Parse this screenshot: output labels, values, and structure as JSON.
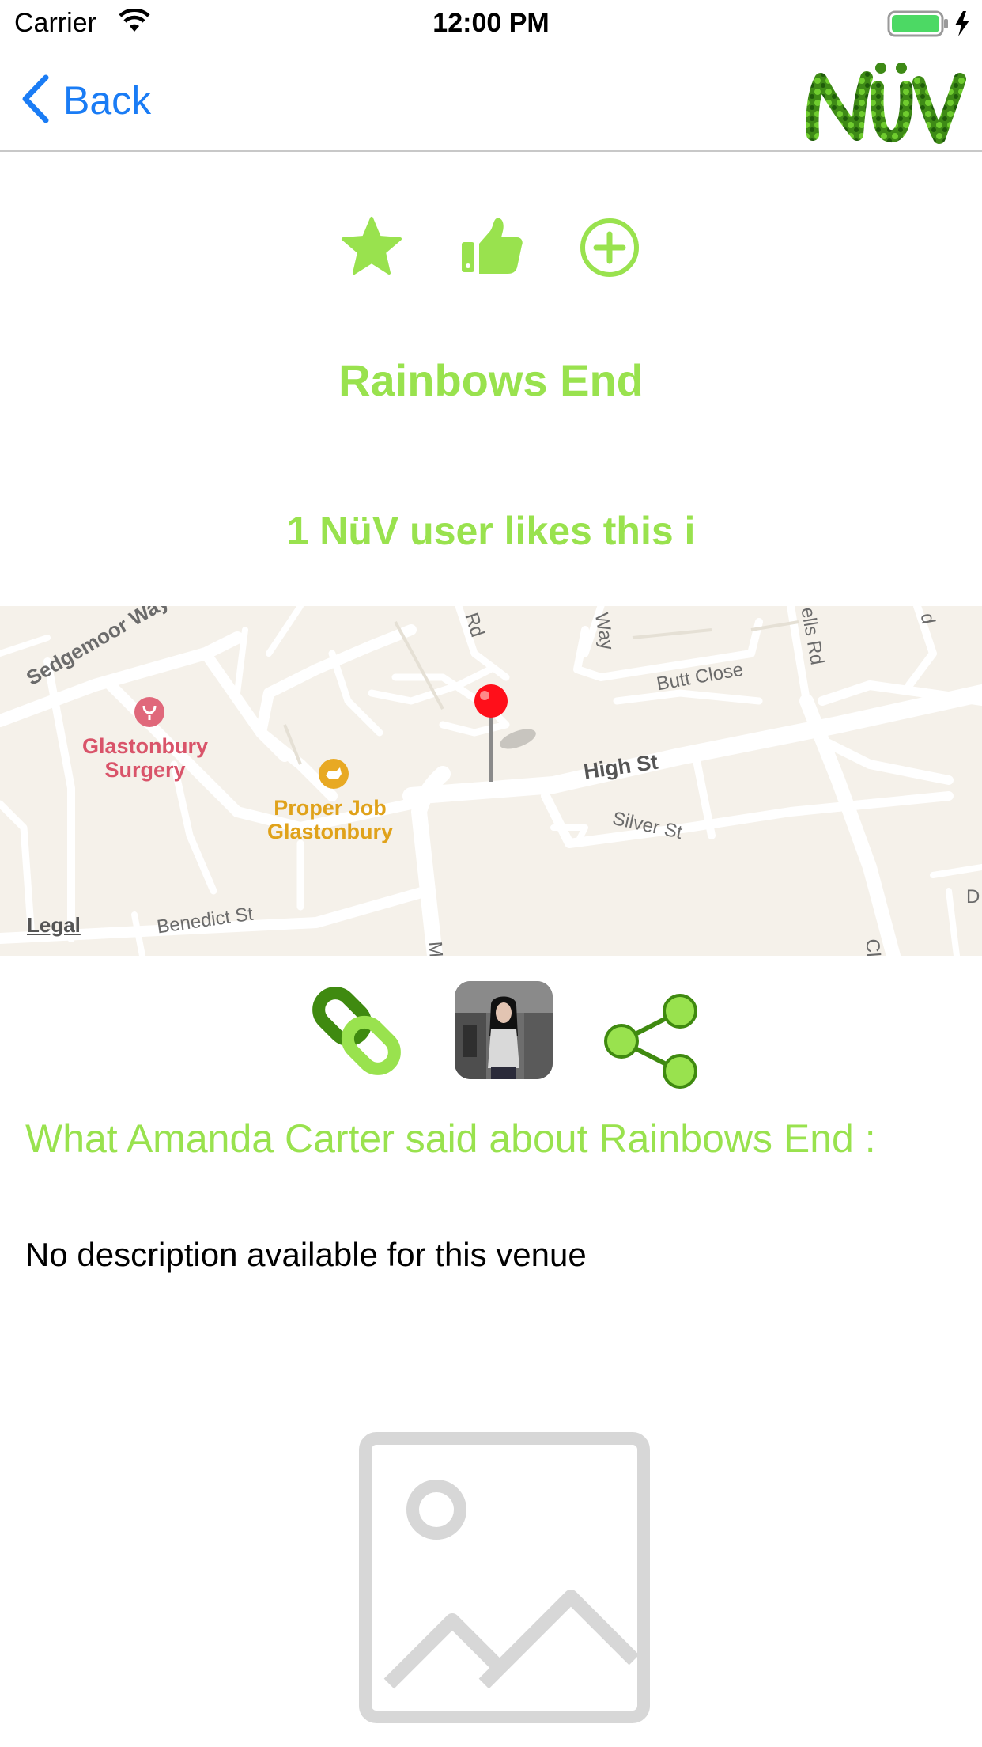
{
  "status_bar": {
    "carrier": "Carrier",
    "time": "12:00 PM"
  },
  "nav": {
    "back_label": "Back",
    "logo_text": "NüV"
  },
  "actions": {
    "favorite_icon": "star-icon",
    "like_icon": "thumbs-up-icon",
    "add_icon": "plus-circle-icon",
    "accent_color": "#99e24e"
  },
  "venue": {
    "name": "Rainbows End",
    "likes_text": "1 NüV user likes this i"
  },
  "map": {
    "streets": [
      "Sedgemoor Way",
      "High St",
      "Butt Close",
      "Silver St",
      "Benedict St",
      "Rd",
      "Way",
      "ells Rd",
      "d",
      "M",
      "Cl",
      "D"
    ],
    "pois": [
      {
        "name_line1": "Glastonbury",
        "name_line2": "Surgery",
        "color": "#d9546a"
      },
      {
        "name_line1": "Proper Job",
        "name_line2": "Glastonbury",
        "color": "#e0a21a"
      }
    ],
    "legal_label": "Legal"
  },
  "links": {
    "link_icon": "chain-link-icon",
    "share_icon": "share-icon"
  },
  "review": {
    "heading": "What Amanda Carter said about Rainbows End :",
    "description": "No description available for this venue"
  }
}
